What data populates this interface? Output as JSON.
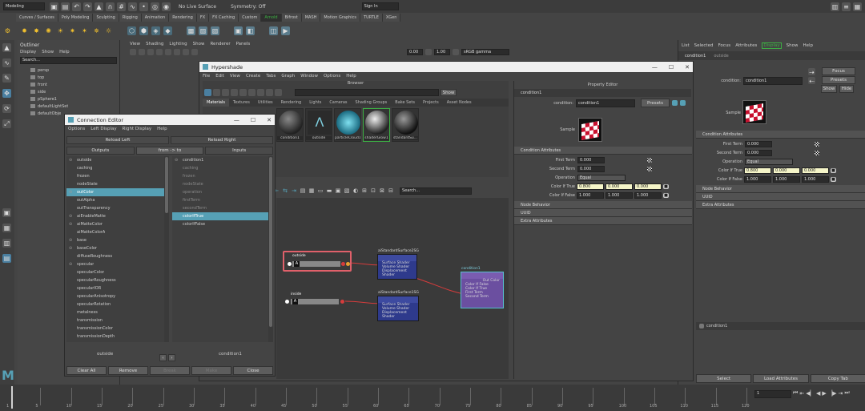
{
  "app": {
    "workspace": "Modeling",
    "live_surface": "No Live Surface",
    "symmetry": "Symmetry: Off",
    "sign_in": "Sign In"
  },
  "shelf_tabs": [
    "Curves / Surfaces",
    "Poly Modeling",
    "Sculpting",
    "Rigging",
    "Animation",
    "Rendering",
    "FX",
    "FX Caching",
    "Custom",
    "Arnold",
    "Bifrost",
    "MASH",
    "Motion Graphics",
    "TURTLE",
    "XGen"
  ],
  "shelf_active": "Arnold",
  "outliner": {
    "title": "Outliner",
    "menu": [
      "Display",
      "Show",
      "Help"
    ],
    "search": "Search...",
    "items": [
      "persp",
      "top",
      "front",
      "side",
      "pSphere1",
      "defaultLightSet",
      "defaultObje"
    ]
  },
  "viewport": {
    "menu": [
      "View",
      "Shading",
      "Lighting",
      "Show",
      "Renderer",
      "Panels"
    ],
    "v1": "0.00",
    "v2": "1.00",
    "colorspace": "sRGB gamma"
  },
  "right_panel": {
    "menu": [
      "List",
      "Selected",
      "Focus",
      "Attributes",
      "Display",
      "Show",
      "Help"
    ],
    "node_tab": "outside",
    "tab_ae": "condition1",
    "cond_label": "condition:",
    "cond_value": "condition1",
    "focus": "Focus",
    "presets": "Presets",
    "show": "Show",
    "hide": "Hide",
    "sample": "Sample",
    "sec_attr": "Condition Attributes",
    "first_term": "First Term",
    "first_val": "0.000",
    "second_term": "Second Term",
    "second_val": "0.000",
    "operation": "Operation",
    "op_val": "Equal",
    "if_true": "Color If True",
    "if_true_vals": [
      "0.800",
      "0.000",
      "0.000"
    ],
    "if_false": "Color If False",
    "if_false_vals": [
      "1.000",
      "1.000",
      "1.000"
    ],
    "node_behavior": "Node Behavior",
    "uuid": "UUID",
    "extra": "Extra Attributes",
    "bottom_node": "condition1",
    "buttons": [
      "Select",
      "Load Attributes",
      "Copy Tab"
    ]
  },
  "hypershade": {
    "title": "Hypershade",
    "menu": [
      "File",
      "Edit",
      "View",
      "Create",
      "Tabs",
      "Graph",
      "Window",
      "Options",
      "Help"
    ],
    "browser": "Browser",
    "show": "Show",
    "tabs": [
      "Materials",
      "Textures",
      "Utilities",
      "Rendering",
      "Lights",
      "Cameras",
      "Shading Groups",
      "Bake Sets",
      "Projects",
      "Asset Nodes"
    ],
    "swatches": [
      "condition1",
      "outside",
      "particleCloud1",
      "shaderGlow1",
      "standardSu..."
    ],
    "search": "Search...",
    "prop_editor": "Property Editor",
    "prop_tab": "condition1",
    "cond_label": "condition:",
    "cond_value": "condition1",
    "presets": "Presets",
    "sample": "Sample",
    "sec_attr": "Condition Attributes",
    "first_term": "First Term",
    "first_val": "0.000",
    "second_term": "Second Term",
    "second_val": "0.000",
    "operation": "Operation",
    "op_val": "Equal",
    "if_true": "Color If True",
    "if_true_vals": [
      "0.800",
      "0.000",
      "0.000"
    ],
    "if_false": "Color If False",
    "if_false_vals": [
      "1.000",
      "1.000",
      "1.000"
    ],
    "node_behavior": "Node Behavior",
    "uuid": "UUID",
    "extra": "Extra Attributes"
  },
  "graph": {
    "node_outside": "outside",
    "node_inside": "inside",
    "node_surf1": "aiStandardSurface2SG",
    "node_surf2": "aiStandardSurface1SG",
    "node_cond": "condition1",
    "surf_ports": [
      "Surface Shader",
      "Volume Shader",
      "Displacement Shader"
    ],
    "cond_ports": [
      "Out Color",
      "Color If False",
      "Color If True",
      "First Term",
      "Second Term"
    ]
  },
  "connection_editor": {
    "title": "Connection Editor",
    "menu": [
      "Options",
      "Left Display",
      "Right Display",
      "Help"
    ],
    "reload_left": "Reload Left",
    "reload_right": "Reload Right",
    "outputs": "Outputs",
    "from_to": "from -> to",
    "inputs": "Inputs",
    "left_items": [
      "outside",
      "caching",
      "frozen",
      "nodeState",
      "outColor",
      "outAlpha",
      "outTransparency",
      "aiEnableMatte",
      "aiMatteColor",
      "aiMatteColorA",
      "base",
      "baseColor",
      "diffuseRoughness",
      "specular",
      "specularColor",
      "specularRoughness",
      "specularIOR",
      "specularAnisotropy",
      "specularRotation",
      "metalness",
      "transmission",
      "transmissionColor",
      "transmissionDepth"
    ],
    "left_selected": "outColor",
    "right_items": [
      "condition1",
      "caching",
      "frozen",
      "nodeState",
      "operation",
      "firstTerm",
      "secondTerm",
      "colorIfTrue",
      "colorIfFalse"
    ],
    "right_selected": "colorIfTrue",
    "left_node": "outside",
    "right_node": "condition1",
    "buttons": [
      "Clear All",
      "Remove",
      "Break",
      "Make",
      "Close"
    ]
  },
  "timeline": {
    "ticks": [
      "1",
      "5",
      "10",
      "15",
      "20",
      "25",
      "30",
      "35",
      "40",
      "45",
      "50",
      "55",
      "60",
      "65",
      "70",
      "75",
      "80",
      "85",
      "90",
      "95",
      "100",
      "105",
      "110",
      "115",
      "120"
    ],
    "frame": "1",
    "end": "120"
  },
  "colors": {
    "accent_teal": "#56a0b5",
    "arnold_green": "#3cb043",
    "yellow_field": "#f5f5c8",
    "node_blue": "#2e3a8c",
    "node_purple": "#6b4fa0"
  }
}
